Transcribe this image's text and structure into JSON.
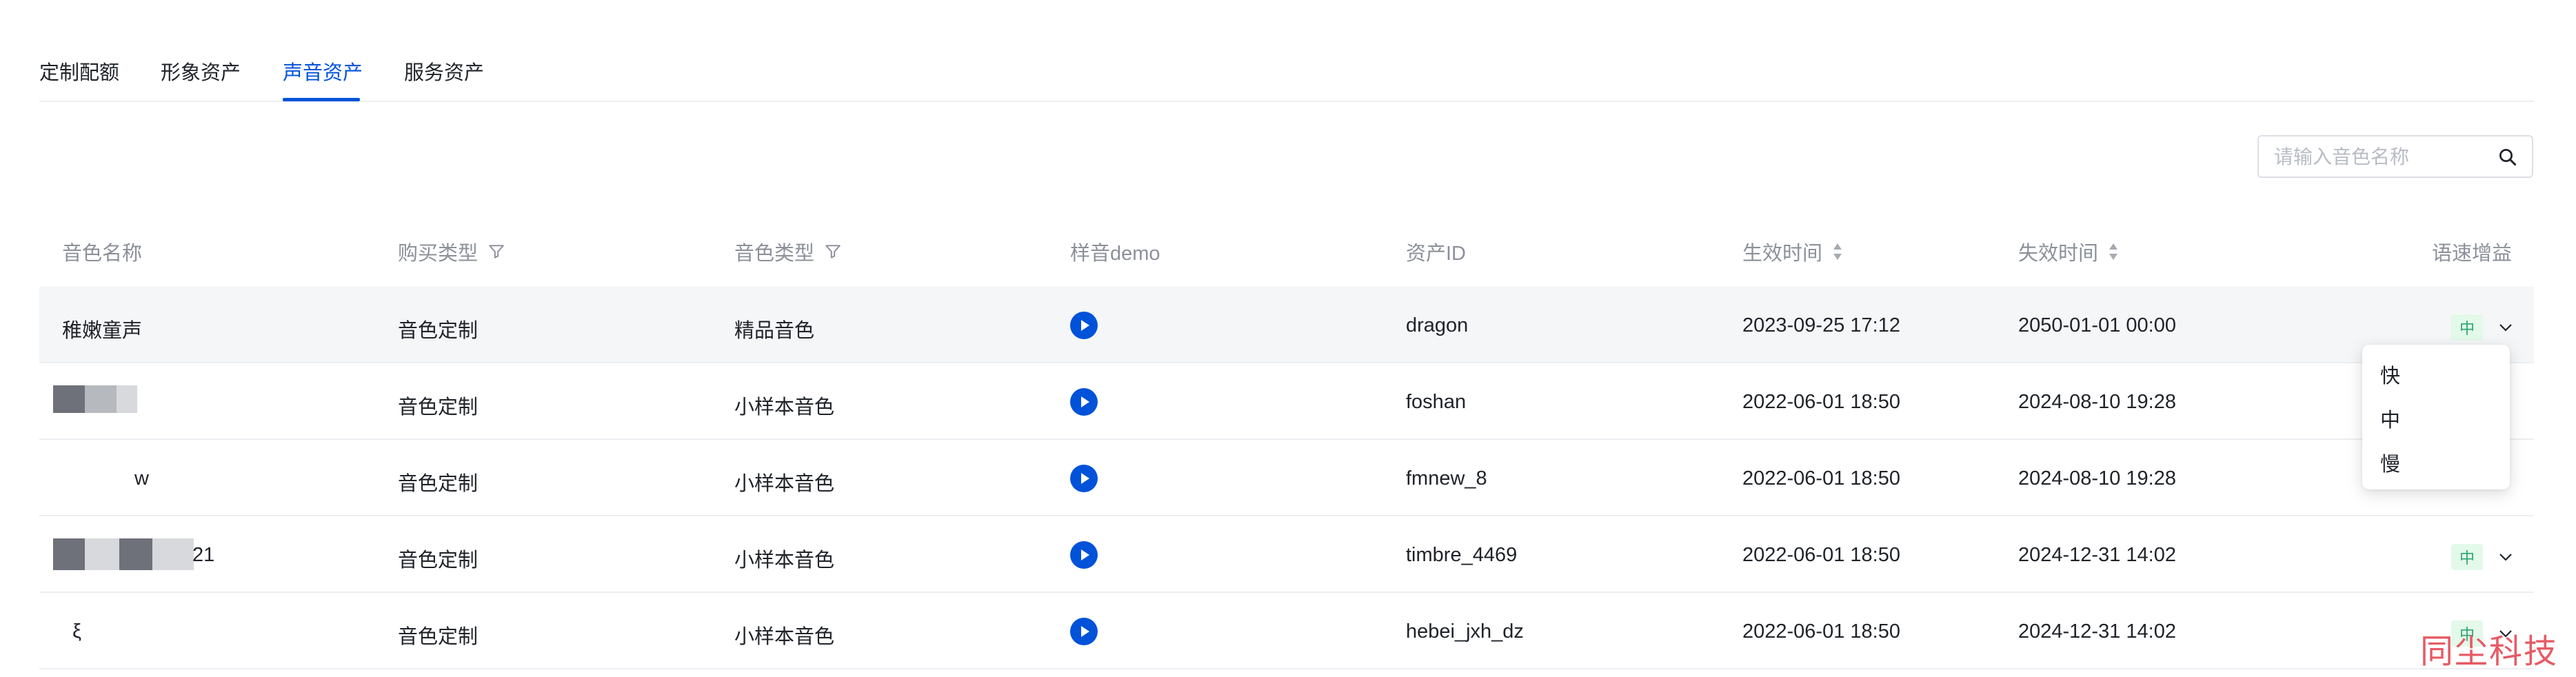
{
  "tabs": [
    {
      "label": "定制配额",
      "active": false
    },
    {
      "label": "形象资产",
      "active": false
    },
    {
      "label": "声音资产",
      "active": true
    },
    {
      "label": "服务资产",
      "active": false
    }
  ],
  "search": {
    "placeholder": "请输入音色名称",
    "value": ""
  },
  "table": {
    "columns": {
      "name": "音色名称",
      "purchase_type": "购买类型",
      "voice_type": "音色类型",
      "demo": "样音demo",
      "asset_id": "资产ID",
      "start_time": "生效时间",
      "end_time": "失效时间",
      "speed_gain": "语速增益"
    },
    "rows": [
      {
        "name": "稚嫩童声",
        "purchase_type": "音色定制",
        "voice_type": "精品音色",
        "asset_id": "dragon",
        "start_time": "2023-09-25 17:12",
        "end_time": "2050-01-01 00:00",
        "speed": "中"
      },
      {
        "name": "",
        "purchase_type": "音色定制",
        "voice_type": "小样本音色",
        "asset_id": "foshan",
        "start_time": "2022-06-01 18:50",
        "end_time": "2024-08-10 19:28",
        "speed": ""
      },
      {
        "name": "w",
        "purchase_type": "音色定制",
        "voice_type": "小样本音色",
        "asset_id": "fmnew_8",
        "start_time": "2022-06-01 18:50",
        "end_time": "2024-08-10 19:28",
        "speed": ""
      },
      {
        "name": "21",
        "purchase_type": "音色定制",
        "voice_type": "小样本音色",
        "asset_id": "timbre_4469",
        "start_time": "2022-06-01 18:50",
        "end_time": "2024-12-31 14:02",
        "speed": "中"
      },
      {
        "name": "ξ",
        "purchase_type": "音色定制",
        "voice_type": "小样本音色",
        "asset_id": "hebei_jxh_dz",
        "start_time": "2022-06-01 18:50",
        "end_time": "2024-12-31 14:02",
        "speed": "中"
      }
    ]
  },
  "speed_dropdown": {
    "options": [
      "快",
      "中",
      "慢"
    ]
  },
  "watermark": "同尘科技",
  "colors": {
    "accent": "#0052d9",
    "speed_badge_bg": "#e3f9e9",
    "speed_badge_text": "#2ba471"
  },
  "icons": {
    "search": "search-icon",
    "filter": "filter-icon",
    "sort": "sort-icon",
    "play": "play-icon",
    "chevron": "chevron-down-icon"
  }
}
